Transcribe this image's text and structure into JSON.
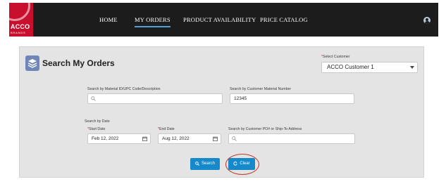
{
  "brand": {
    "name": "ACCO",
    "sub": "BRANDS",
    "color": "#c8102e"
  },
  "nav": {
    "items": [
      {
        "label": "HOME",
        "active": false
      },
      {
        "label": "MY ORDERS",
        "active": true
      },
      {
        "label": "PRODUCT AVAILABILITY",
        "active": false
      },
      {
        "label": "PRICE CATALOG",
        "active": false
      }
    ],
    "user_icon": "user-avatar-icon",
    "accent": "#4da3d9"
  },
  "page": {
    "title": "Search My Orders",
    "icon": "stacked-layers-icon"
  },
  "customer": {
    "required_mark": "*",
    "label": "Select Customer",
    "value": "ACCO Customer 1"
  },
  "filters": {
    "material_label": "Search by Material ID/UPC Code/Description",
    "material_value": "",
    "customer_material_label": "Search by Customer Material Number",
    "customer_material_value": "12345",
    "date_section_label": "Search by Date",
    "start_required": "*",
    "start_label": "Start Date",
    "start_value": "Feb 12, 2022",
    "end_required": "*",
    "end_label": "End Date",
    "end_value": "Aug 12, 2022",
    "po_label": "Search by Customer PO# or Ship-To Address",
    "po_value": ""
  },
  "actions": {
    "search_label": "Search",
    "clear_label": "Clear",
    "button_color": "#1589c9",
    "highlight_color": "#c0392b"
  }
}
